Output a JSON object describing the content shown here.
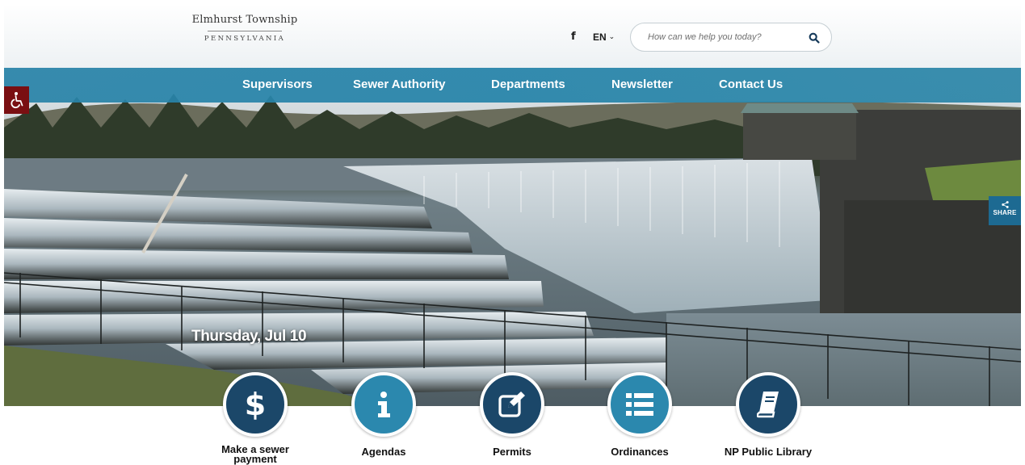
{
  "site": {
    "name": "Elmhurst Township",
    "state": "PENNSYLVANIA"
  },
  "header": {
    "social_icon": "facebook-icon",
    "social_label": "f",
    "language": "EN",
    "search_placeholder": "How can we help you today?"
  },
  "nav": {
    "items": [
      {
        "label": "Supervisors"
      },
      {
        "label": "Sewer Authority"
      },
      {
        "label": "Departments"
      },
      {
        "label": "Newsletter"
      },
      {
        "label": "Contact Us"
      }
    ]
  },
  "share": {
    "label": "SHARE"
  },
  "hero": {
    "date": "Thursday, Jul 10"
  },
  "quick_links": [
    {
      "label": "Make a sewer payment",
      "icon": "dollar-icon"
    },
    {
      "label": "Agendas",
      "icon": "info-icon"
    },
    {
      "label": "Permits",
      "icon": "edit-icon"
    },
    {
      "label": "Ordinances",
      "icon": "list-icon"
    },
    {
      "label": "NP Public Library",
      "icon": "book-icon"
    }
  ],
  "colors": {
    "nav_bg": "#2885a8",
    "accessibility_bg": "#7a0f12",
    "share_bg": "#1d6a92",
    "circle_dark": "#1b4769",
    "circle_light": "#2b88ae"
  }
}
